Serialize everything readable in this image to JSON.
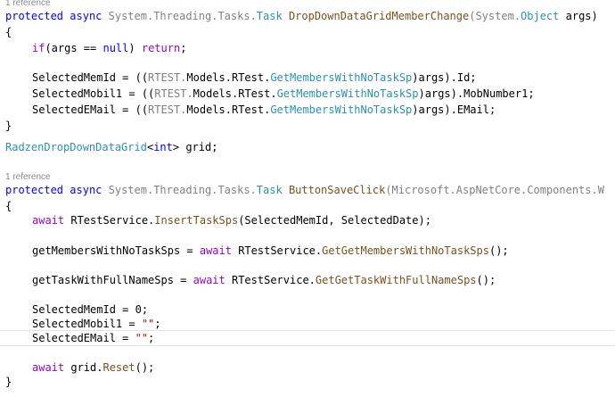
{
  "codelens": {
    "ref_1": "1 reference",
    "ref_2": "1 reference"
  },
  "method1": {
    "protected": "protected",
    "async": "async",
    "return_ns": "System.Threading.Tasks.",
    "return_type": "Task",
    "name": "DropDownDataGridMemberChange",
    "param_ns": "(System.",
    "param_type": "Object",
    "param_name": " args)",
    "open_brace": "{",
    "if_kw": "if",
    "if_cond_a": "(args == ",
    "null_kw": "null",
    "if_cond_b": ") ",
    "return_kw": "return",
    "if_end": ";",
    "assign1_a": "SelectedMemId = ((",
    "assign1_ns": "RTEST.",
    "assign1_b": "Models.RTest.",
    "assign1_cls": "GetMembersWithNoTaskSp",
    "assign1_c": ")args).Id;",
    "assign2_a": "SelectedMobil1 = ((",
    "assign2_ns": "RTEST.",
    "assign2_b": "Models.RTest.",
    "assign2_cls": "GetMembersWithNoTaskSp",
    "assign2_c": ")args).MobNumber1;",
    "assign3_a": "SelectedEMail = ((",
    "assign3_ns": "RTEST.",
    "assign3_b": "Models.RTest.",
    "assign3_cls": "GetMembersWithNoTaskSp",
    "assign3_c": ")args).EMail;",
    "close_brace": "}"
  },
  "field": {
    "type": "RadzenDropDownDataGrid",
    "generic_open": "<",
    "generic_kw": "int",
    "generic_close": "> grid;"
  },
  "method2": {
    "protected": "protected",
    "async": "async",
    "return_ns": "System.Threading.Tasks.",
    "return_type": "Task",
    "name": "ButtonSaveClick",
    "param_ns": "(Microsoft.AspNetCore.Components.W",
    "open_brace": "{",
    "l1_await": "await",
    "l1_obj": " RTestService.",
    "l1_meth": "InsertTaskSps",
    "l1_args": "(SelectedMemId, SelectedDate);",
    "l2_a": "getMembersWithNoTaskSps = ",
    "l2_await": "await",
    "l2_obj": " RTestService.",
    "l2_meth": "GetGetMembersWithNoTaskSps",
    "l2_end": "();",
    "l3_a": "getTaskWithFullNameSps = ",
    "l3_await": "await",
    "l3_obj": " RTestService.",
    "l3_meth": "GetGetTaskWithFullNameSps",
    "l3_end": "();",
    "l4": "SelectedMemId = 0;",
    "l5_a": "SelectedMobil1 = ",
    "l5_str": "\"\"",
    "l5_end": ";",
    "l6_a": "SelectedEMail = ",
    "l6_str": "\"\"",
    "l6_end": ";",
    "l7_await": "await",
    "l7_obj": " grid.",
    "l7_meth": "Reset",
    "l7_end": "();",
    "close_brace": "}"
  }
}
